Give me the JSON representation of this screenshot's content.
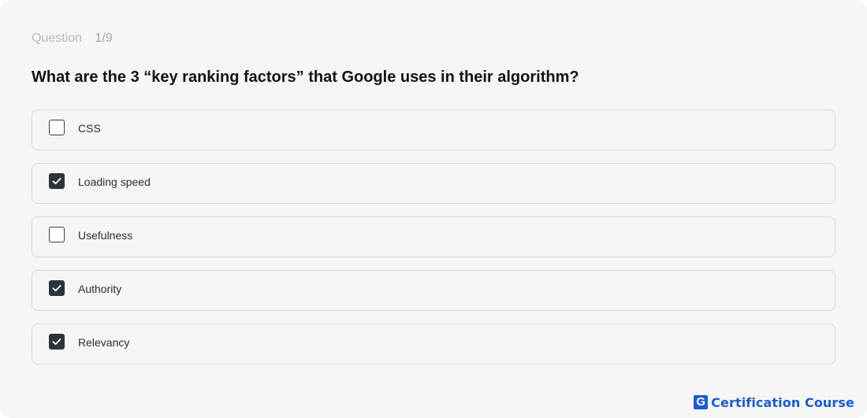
{
  "quiz": {
    "question_label": "Question",
    "question_number": "1/9",
    "question_text": "What are the 3 “key ranking factors” that Google uses in their algorithm?"
  },
  "options": [
    {
      "label": "CSS",
      "checked": false
    },
    {
      "label": "Loading speed",
      "checked": true
    },
    {
      "label": "Usefulness",
      "checked": false
    },
    {
      "label": "Authority",
      "checked": true
    },
    {
      "label": "Relevancy",
      "checked": true
    }
  ],
  "brand": {
    "logo_letter": "G",
    "name": "Certification Course",
    "color": "#1a5bd8"
  },
  "icons": {
    "checkbox_checked": "check-icon"
  }
}
